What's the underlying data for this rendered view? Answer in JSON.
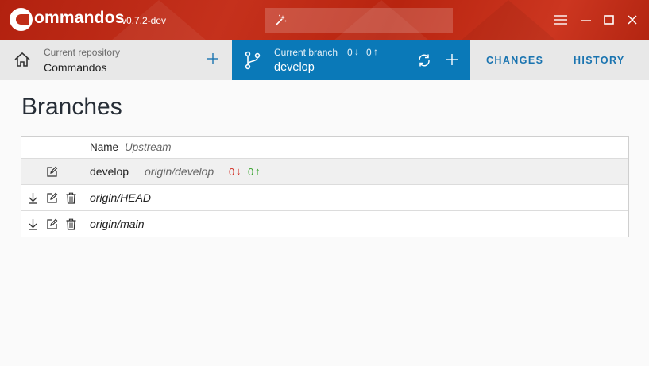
{
  "app": {
    "name": "ommandos",
    "version": "v0.7.2-dev"
  },
  "toolbar": {
    "repository": {
      "label": "Current repository",
      "value": "Commandos"
    },
    "branch": {
      "label": "Current branch",
      "behind": "0",
      "ahead": "0",
      "value": "develop"
    },
    "tabs": [
      "CHANGES",
      "HISTORY"
    ]
  },
  "page": {
    "title": "Branches"
  },
  "table": {
    "header": {
      "name": "Name",
      "upstream": "Upstream"
    },
    "rows": [
      {
        "name": "develop",
        "upstream": "origin/develop",
        "behind": "0",
        "ahead": "0",
        "current": true
      },
      {
        "name": "origin/HEAD",
        "remote": true
      },
      {
        "name": "origin/main",
        "remote": true
      }
    ]
  },
  "colors": {
    "titlebar": "#b8240f",
    "branch_bg": "#0a79b8",
    "tab_text": "#1a74b0",
    "behind": "#d22c22",
    "ahead": "#35a32c"
  }
}
